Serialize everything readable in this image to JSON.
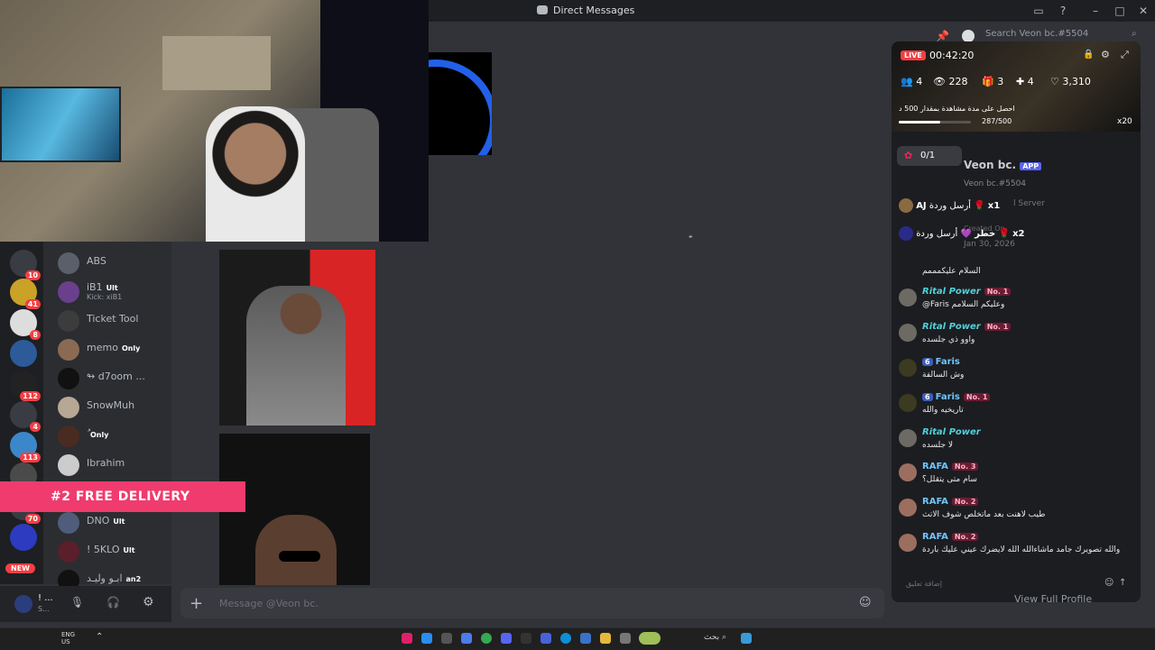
{
  "window": {
    "title": "Direct Messages"
  },
  "search": {
    "placeholder": "Search Veon bc.#5504"
  },
  "server_rail": [
    {
      "badge": "10"
    },
    {
      "badge": "41"
    },
    {
      "badge": "8"
    },
    {
      "badge": ""
    },
    {
      "badge": "112"
    },
    {
      "badge": "4"
    },
    {
      "badge": "113"
    },
    {
      "badge": ""
    },
    {
      "badge": "70"
    },
    {
      "badge": ""
    },
    {
      "badge": "NEW"
    }
  ],
  "dm_list": [
    {
      "name": "ABS",
      "tag": "",
      "sub": ""
    },
    {
      "name": "iB1",
      "tag": "Ult",
      "sub": "Kick: xiB1"
    },
    {
      "name": "Ticket Tool",
      "tag": "",
      "sub": ""
    },
    {
      "name": "memo",
      "tag": "Only",
      "sub": ""
    },
    {
      "name": "↬ d7oom ...",
      "tag": "",
      "sub": ""
    },
    {
      "name": "SnowMuh",
      "tag": "",
      "sub": ""
    },
    {
      "name": "ُ",
      "tag": "Only",
      "sub": ""
    },
    {
      "name": "Ibrahim",
      "tag": "",
      "sub": ""
    },
    {
      "name": "DNO",
      "tag": "Ult",
      "sub": ""
    },
    {
      "name": "! 5KLO",
      "tag": "Ult",
      "sub": ""
    },
    {
      "name": "ابـو وليـد",
      "tag": "an2",
      "sub": ""
    }
  ],
  "banner": {
    "text": "#2 FREE DELIVERY"
  },
  "user_panel": {
    "name": "! ...",
    "status": "S..."
  },
  "message_input": {
    "placeholder": "Message @Veon bc."
  },
  "stream": {
    "live_label": "LIVE",
    "timer": "00:42:20",
    "stats": {
      "viewers_group": "4",
      "views": "228",
      "gifts": "3",
      "followers": "4",
      "likes": "3,310"
    },
    "goal_text": "احصل على مدة مشاهدة بمقدار 500 د",
    "goal_progress": "287/500",
    "goal_fraction": 0.574,
    "multiplier": "x20",
    "streamer_name": "Veon bc.",
    "app_tag": "APP",
    "streamer_handle": "Veon bc.#5504",
    "server_hint": "l Server",
    "created_label": "Created On",
    "created_date": "Jan 30, 2026",
    "rose_counter": "0/1",
    "gifts": [
      {
        "user": "AJ",
        "text": "أرسل وردة",
        "count": "x1"
      },
      {
        "user": "خطر",
        "text": "أرسل وردة",
        "count": "x2"
      }
    ],
    "chat": [
      {
        "user": "",
        "level": "",
        "rank": "",
        "text": "السلام عليكمممم"
      },
      {
        "user": "Rital Power",
        "level": "",
        "rank": "No. 1",
        "text": "@Faris وعليكم السلامم"
      },
      {
        "user": "Rital Power",
        "level": "",
        "rank": "No. 1",
        "text": "واوو ذي جلسده"
      },
      {
        "user": "Faris",
        "level": "6",
        "rank": "",
        "text": "وش السالفة"
      },
      {
        "user": "Faris",
        "level": "6",
        "rank": "No. 1",
        "text": "تاريخيه والله"
      },
      {
        "user": "Rital Power",
        "level": "",
        "rank": "",
        "text": "لا جلسده"
      },
      {
        "user": "RAFA",
        "level": "",
        "rank": "No. 3",
        "text": "سام متى يتقلل؟"
      },
      {
        "user": "RAFA",
        "level": "",
        "rank": "No. 2",
        "text": "طيب لاهنت بعد ماتخلص شوف الاتث"
      },
      {
        "user": "RAFA",
        "level": "",
        "rank": "No. 2",
        "text": "والله تصويرك جامد ماشاءالله الله لايضرك عيني عليك باردة"
      }
    ],
    "input_placeholder": "إضافة تعليق",
    "view_profile": "View Full Profile"
  },
  "taskbar": {
    "lang": "ENG",
    "region": "US",
    "search_hint": "بحث"
  },
  "colors": {
    "accent": "#5865f2",
    "live": "#f23f43",
    "banner": "#ef3b6e",
    "rital": "#4fd1d9",
    "rafa": "#6ec6ff"
  }
}
